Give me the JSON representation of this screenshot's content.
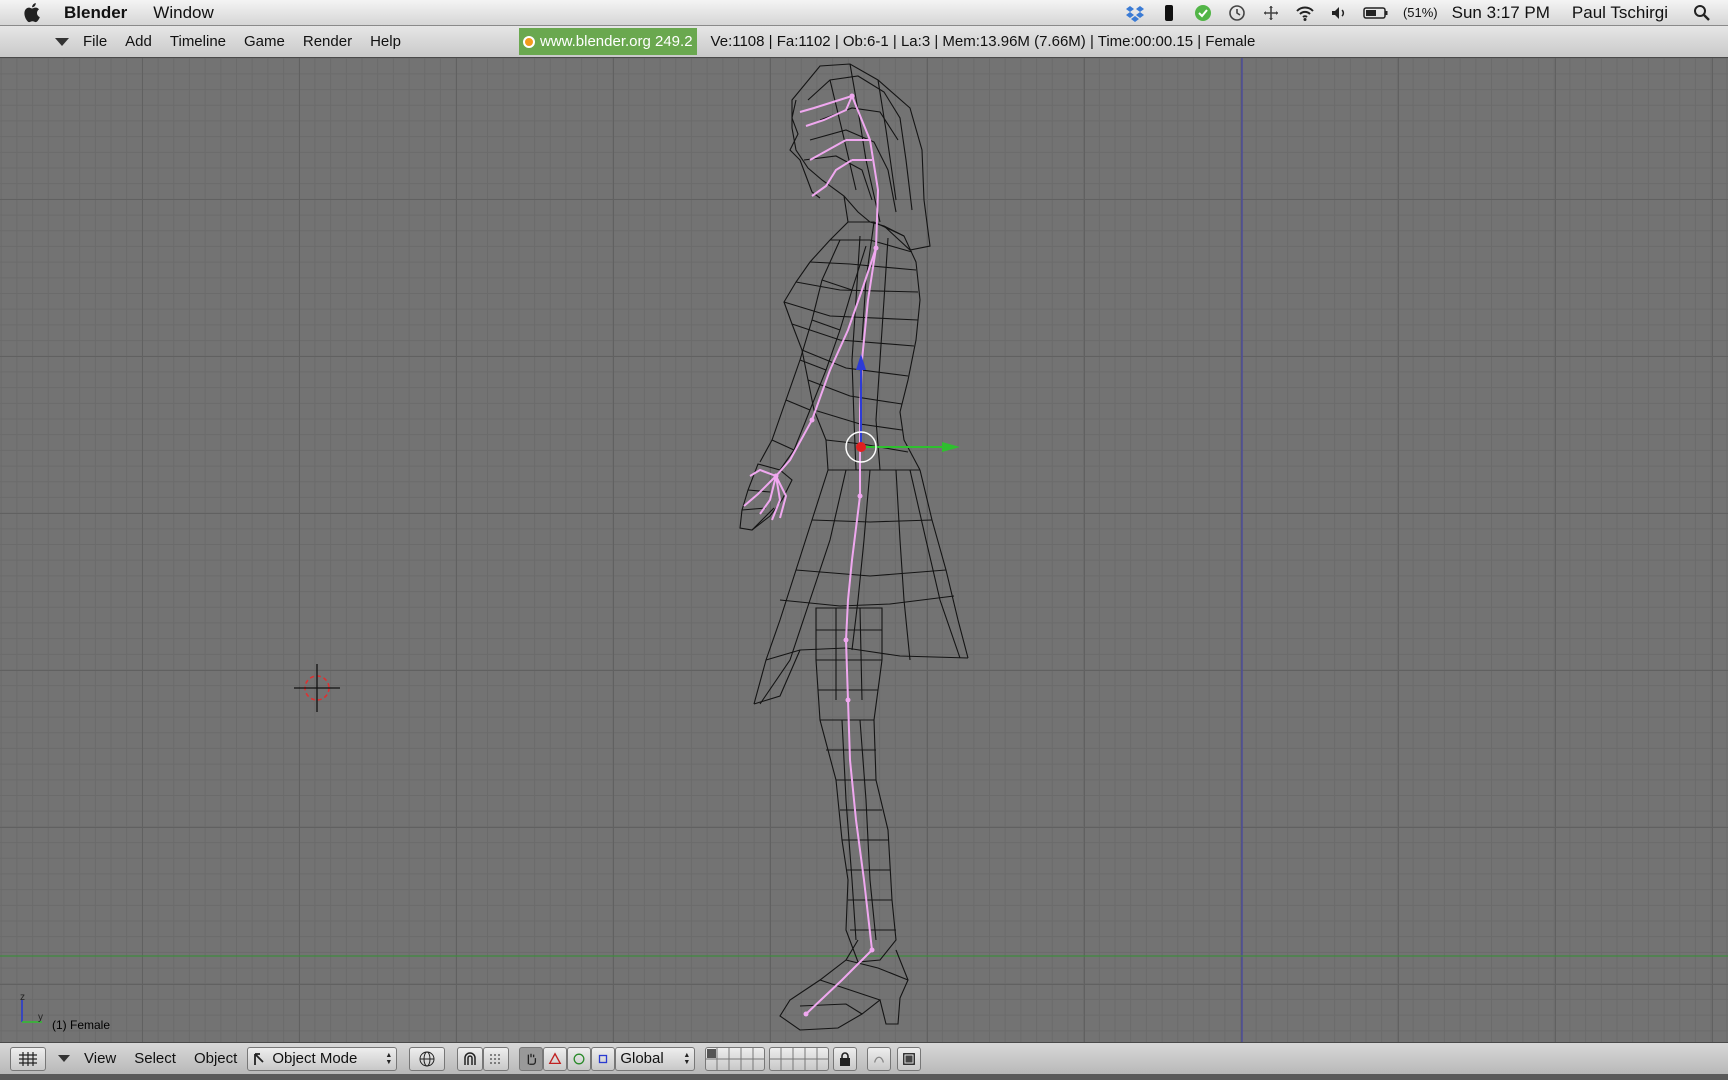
{
  "os_menubar": {
    "app_name": "Blender",
    "menus": [
      "Window"
    ],
    "battery": "(51%)",
    "clock": "Sun 3:17 PM",
    "user": "Paul Tschirgi"
  },
  "info_header": {
    "menus": [
      "File",
      "Add",
      "Timeline",
      "Game",
      "Render",
      "Help"
    ],
    "version": "www.blender.org 249.2",
    "stats": "Ve:1108 | Fa:1102 | Ob:6-1 | La:3  | Mem:13.96M (7.66M)  | Time:00:00.15 | Female"
  },
  "viewport": {
    "object_label": "(1) Female",
    "axis_z": "z",
    "axis_y": "y"
  },
  "view3d_header": {
    "menus": [
      "View",
      "Select",
      "Object"
    ],
    "mode": "Object Mode",
    "orientation": "Global"
  },
  "colors": {
    "grid_bg": "#737373",
    "armature": "#f0a0f0",
    "version_badge": "#6aa84f"
  }
}
